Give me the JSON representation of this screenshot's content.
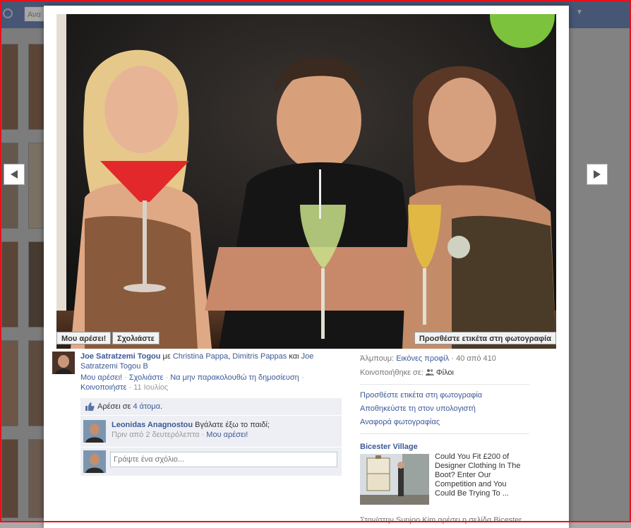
{
  "background": {
    "search_placeholder": "Ανα"
  },
  "photo_buttons": {
    "like": "Μου αρέσει!",
    "comment": "Σχολιάστε",
    "tag": "Προσθέστε ετικέτα στη φωτογραφία"
  },
  "post": {
    "author": "Joe Satratzemi Togou",
    "with_word": "με",
    "tagged_1": "Christina Pappa",
    "comma": ",",
    "tagged_2": "Dimitris Pappas",
    "and_word": "και",
    "tagged_3": "Joe Satratzemi Togou B",
    "action_like": "Μου αρέσει!",
    "action_comment": "Σχολιάστε",
    "action_unfollow": "Να μην παρακολουθώ τη δημοσίευση",
    "action_share": "Κοινοποιήστε",
    "date": "11 Ιουλίος",
    "separator": "·"
  },
  "feedback": {
    "likes_prefix": "Αρέσει σε",
    "likes_count": "4 άτομα",
    "likes_suffix": ".",
    "comment": {
      "author": "Leonidas Anagnostou",
      "text": "Βγάλατε έξω το παιδί;",
      "time": "Πριν από 2 δευτερόλεπτα",
      "like": "Μου αρέσει!"
    },
    "write_placeholder": "Γράψτε ένα σχόλιο..."
  },
  "info": {
    "album_label": "Άλμπουμ:",
    "album_name": "Εικόνες προφίλ",
    "position": "· 40 από 410",
    "shared_label": "Κοινοποιήθηκε σε:",
    "shared_value": "Φίλοι",
    "links": [
      "Προσθέστε ετικέτα στη φωτογραφία",
      "Αποθηκεύστε τη στον υπολογιστή",
      "Αναφορά φωτογραφίας"
    ]
  },
  "ad": {
    "title": "Bicester Village",
    "text": "Could You Fit £200 of Designer Clothing In The Boot? Enter Our Competition and You Could Be Trying To ...",
    "social": "Στον/στην Sunjoo Kim αρέσει η σελίδα Bicester"
  }
}
